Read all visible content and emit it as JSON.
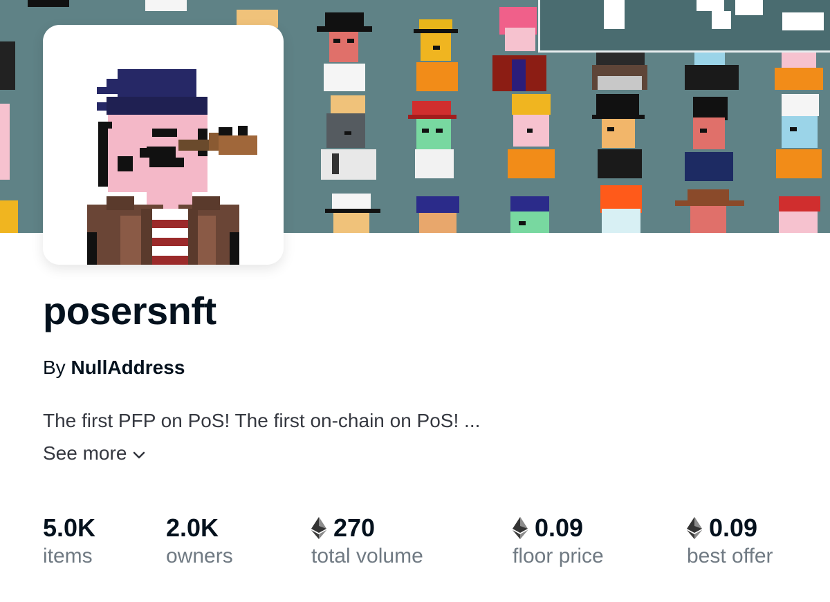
{
  "collection": {
    "name": "posersnft",
    "by_prefix": "By",
    "creator": "NullAddress",
    "description": "The first PFP on PoS! The first on-chain on PoS! ...",
    "see_more_label": "See more"
  },
  "stats": [
    {
      "value": "5.0K",
      "label": "items",
      "eth": false
    },
    {
      "value": "2.0K",
      "label": "owners",
      "eth": false
    },
    {
      "value": "270",
      "label": "total volume",
      "eth": true
    },
    {
      "value": "0.09",
      "label": "floor price",
      "eth": true
    },
    {
      "value": "0.09",
      "label": "best offer",
      "eth": true
    }
  ],
  "colors": {
    "banner_bg": "#5f8286",
    "title": "#04111d",
    "secondary_text": "#707a83"
  },
  "icons": {
    "eth": "ethereum-icon",
    "see_more": "chevron-down-icon"
  }
}
